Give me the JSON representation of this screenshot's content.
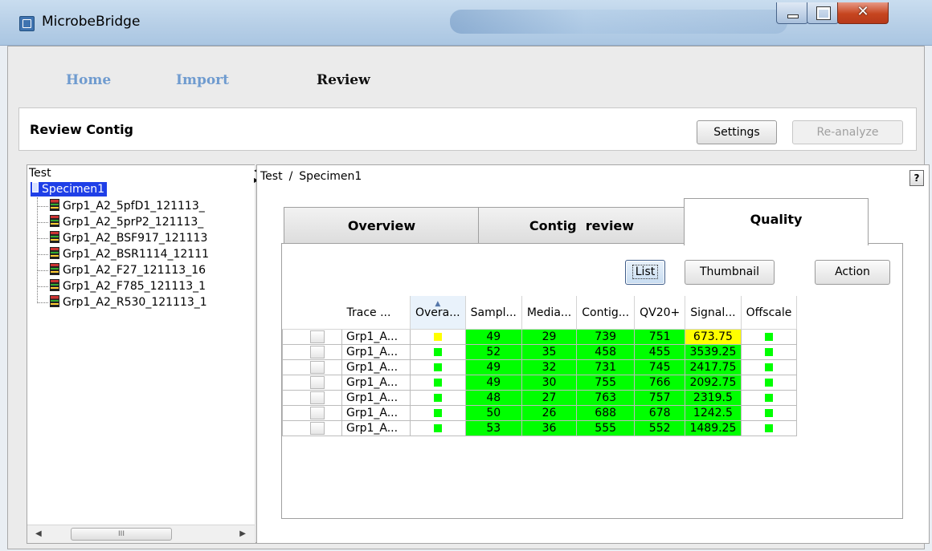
{
  "window": {
    "title": "MicrobeBridge"
  },
  "nav": {
    "home": "Home",
    "import": "Import",
    "review": "Review"
  },
  "header": {
    "title": "Review Contig",
    "settings_label": "Settings",
    "reanalyze_label": "Re-analyze"
  },
  "tree": {
    "root": "Test",
    "specimen": "Specimen1",
    "items": [
      "Grp1_A2_5pfD1_121113_",
      "Grp1_A2_5prP2_121113_",
      "Grp1_A2_BSF917_121113",
      "Grp1_A2_BSR1114_12111",
      "Grp1_A2_F27_121113_16",
      "Grp1_A2_F785_121113_1",
      "Grp1_A2_R530_121113_1"
    ],
    "scroll_thumb_label": "III"
  },
  "breadcrumb": {
    "root": "Test",
    "separator": "/",
    "current": "Specimen1"
  },
  "help_label": "?",
  "tabs": {
    "overview": "Overview",
    "contig_review": "Contig  review",
    "quality": "Quality"
  },
  "quality": {
    "list_label": "List",
    "thumbnail_label": "Thumbnail",
    "action_label": "Action",
    "columns": [
      "Trace ...",
      "Overa...",
      "Sampl...",
      "Media...",
      "Contig...",
      "QV20+",
      "Signal...",
      "Offscale"
    ],
    "colors": {
      "green": "#00ff00",
      "yellow": "#ffff00"
    },
    "rows": [
      {
        "trace": "Grp1_A...",
        "overall": "yellow",
        "sample": "49",
        "median": "29",
        "contig": "739",
        "qv20": "751",
        "signal": "673.75",
        "signal_color": "yellow",
        "offscale": "green"
      },
      {
        "trace": "Grp1_A...",
        "overall": "green",
        "sample": "52",
        "median": "35",
        "contig": "458",
        "qv20": "455",
        "signal": "3539.25",
        "signal_color": "green",
        "offscale": "green"
      },
      {
        "trace": "Grp1_A...",
        "overall": "green",
        "sample": "49",
        "median": "32",
        "contig": "731",
        "qv20": "745",
        "signal": "2417.75",
        "signal_color": "green",
        "offscale": "green"
      },
      {
        "trace": "Grp1_A...",
        "overall": "green",
        "sample": "49",
        "median": "30",
        "contig": "755",
        "qv20": "766",
        "signal": "2092.75",
        "signal_color": "green",
        "offscale": "green"
      },
      {
        "trace": "Grp1_A...",
        "overall": "green",
        "sample": "48",
        "median": "27",
        "contig": "763",
        "qv20": "757",
        "signal": "2319.5",
        "signal_color": "green",
        "offscale": "green"
      },
      {
        "trace": "Grp1_A...",
        "overall": "green",
        "sample": "50",
        "median": "26",
        "contig": "688",
        "qv20": "678",
        "signal": "1242.5",
        "signal_color": "green",
        "offscale": "green"
      },
      {
        "trace": "Grp1_A...",
        "overall": "green",
        "sample": "53",
        "median": "36",
        "contig": "555",
        "qv20": "552",
        "signal": "1489.25",
        "signal_color": "green",
        "offscale": "green"
      }
    ]
  }
}
